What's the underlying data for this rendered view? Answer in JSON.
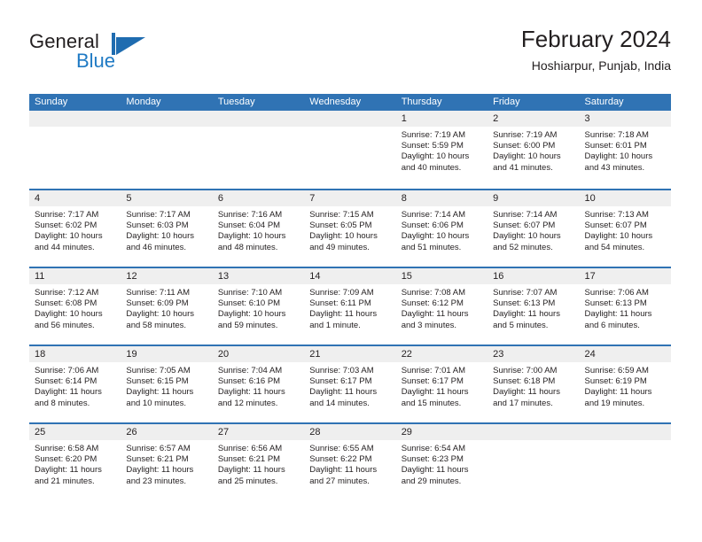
{
  "brand": {
    "name_part1": "General",
    "name_part2": "Blue",
    "accent_color": "#1f7ac4",
    "mark_color": "#1f6cb0"
  },
  "header": {
    "title": "February 2024",
    "subtitle": "Hoshiarpur, Punjab, India"
  },
  "theme": {
    "header_blue": "#3073b4",
    "day_band_gray": "#efefef",
    "text": "#231f20"
  },
  "weekday_headers": [
    "Sunday",
    "Monday",
    "Tuesday",
    "Wednesday",
    "Thursday",
    "Friday",
    "Saturday"
  ],
  "weeks": [
    {
      "days": [
        {
          "num": "",
          "lines": []
        },
        {
          "num": "",
          "lines": []
        },
        {
          "num": "",
          "lines": []
        },
        {
          "num": "",
          "lines": []
        },
        {
          "num": "1",
          "lines": [
            "Sunrise: 7:19 AM",
            "Sunset: 5:59 PM",
            "Daylight: 10 hours",
            "and 40 minutes."
          ]
        },
        {
          "num": "2",
          "lines": [
            "Sunrise: 7:19 AM",
            "Sunset: 6:00 PM",
            "Daylight: 10 hours",
            "and 41 minutes."
          ]
        },
        {
          "num": "3",
          "lines": [
            "Sunrise: 7:18 AM",
            "Sunset: 6:01 PM",
            "Daylight: 10 hours",
            "and 43 minutes."
          ]
        }
      ]
    },
    {
      "days": [
        {
          "num": "4",
          "lines": [
            "Sunrise: 7:17 AM",
            "Sunset: 6:02 PM",
            "Daylight: 10 hours",
            "and 44 minutes."
          ]
        },
        {
          "num": "5",
          "lines": [
            "Sunrise: 7:17 AM",
            "Sunset: 6:03 PM",
            "Daylight: 10 hours",
            "and 46 minutes."
          ]
        },
        {
          "num": "6",
          "lines": [
            "Sunrise: 7:16 AM",
            "Sunset: 6:04 PM",
            "Daylight: 10 hours",
            "and 48 minutes."
          ]
        },
        {
          "num": "7",
          "lines": [
            "Sunrise: 7:15 AM",
            "Sunset: 6:05 PM",
            "Daylight: 10 hours",
            "and 49 minutes."
          ]
        },
        {
          "num": "8",
          "lines": [
            "Sunrise: 7:14 AM",
            "Sunset: 6:06 PM",
            "Daylight: 10 hours",
            "and 51 minutes."
          ]
        },
        {
          "num": "9",
          "lines": [
            "Sunrise: 7:14 AM",
            "Sunset: 6:07 PM",
            "Daylight: 10 hours",
            "and 52 minutes."
          ]
        },
        {
          "num": "10",
          "lines": [
            "Sunrise: 7:13 AM",
            "Sunset: 6:07 PM",
            "Daylight: 10 hours",
            "and 54 minutes."
          ]
        }
      ]
    },
    {
      "days": [
        {
          "num": "11",
          "lines": [
            "Sunrise: 7:12 AM",
            "Sunset: 6:08 PM",
            "Daylight: 10 hours",
            "and 56 minutes."
          ]
        },
        {
          "num": "12",
          "lines": [
            "Sunrise: 7:11 AM",
            "Sunset: 6:09 PM",
            "Daylight: 10 hours",
            "and 58 minutes."
          ]
        },
        {
          "num": "13",
          "lines": [
            "Sunrise: 7:10 AM",
            "Sunset: 6:10 PM",
            "Daylight: 10 hours",
            "and 59 minutes."
          ]
        },
        {
          "num": "14",
          "lines": [
            "Sunrise: 7:09 AM",
            "Sunset: 6:11 PM",
            "Daylight: 11 hours",
            "and 1 minute."
          ]
        },
        {
          "num": "15",
          "lines": [
            "Sunrise: 7:08 AM",
            "Sunset: 6:12 PM",
            "Daylight: 11 hours",
            "and 3 minutes."
          ]
        },
        {
          "num": "16",
          "lines": [
            "Sunrise: 7:07 AM",
            "Sunset: 6:13 PM",
            "Daylight: 11 hours",
            "and 5 minutes."
          ]
        },
        {
          "num": "17",
          "lines": [
            "Sunrise: 7:06 AM",
            "Sunset: 6:13 PM",
            "Daylight: 11 hours",
            "and 6 minutes."
          ]
        }
      ]
    },
    {
      "days": [
        {
          "num": "18",
          "lines": [
            "Sunrise: 7:06 AM",
            "Sunset: 6:14 PM",
            "Daylight: 11 hours",
            "and 8 minutes."
          ]
        },
        {
          "num": "19",
          "lines": [
            "Sunrise: 7:05 AM",
            "Sunset: 6:15 PM",
            "Daylight: 11 hours",
            "and 10 minutes."
          ]
        },
        {
          "num": "20",
          "lines": [
            "Sunrise: 7:04 AM",
            "Sunset: 6:16 PM",
            "Daylight: 11 hours",
            "and 12 minutes."
          ]
        },
        {
          "num": "21",
          "lines": [
            "Sunrise: 7:03 AM",
            "Sunset: 6:17 PM",
            "Daylight: 11 hours",
            "and 14 minutes."
          ]
        },
        {
          "num": "22",
          "lines": [
            "Sunrise: 7:01 AM",
            "Sunset: 6:17 PM",
            "Daylight: 11 hours",
            "and 15 minutes."
          ]
        },
        {
          "num": "23",
          "lines": [
            "Sunrise: 7:00 AM",
            "Sunset: 6:18 PM",
            "Daylight: 11 hours",
            "and 17 minutes."
          ]
        },
        {
          "num": "24",
          "lines": [
            "Sunrise: 6:59 AM",
            "Sunset: 6:19 PM",
            "Daylight: 11 hours",
            "and 19 minutes."
          ]
        }
      ]
    },
    {
      "days": [
        {
          "num": "25",
          "lines": [
            "Sunrise: 6:58 AM",
            "Sunset: 6:20 PM",
            "Daylight: 11 hours",
            "and 21 minutes."
          ]
        },
        {
          "num": "26",
          "lines": [
            "Sunrise: 6:57 AM",
            "Sunset: 6:21 PM",
            "Daylight: 11 hours",
            "and 23 minutes."
          ]
        },
        {
          "num": "27",
          "lines": [
            "Sunrise: 6:56 AM",
            "Sunset: 6:21 PM",
            "Daylight: 11 hours",
            "and 25 minutes."
          ]
        },
        {
          "num": "28",
          "lines": [
            "Sunrise: 6:55 AM",
            "Sunset: 6:22 PM",
            "Daylight: 11 hours",
            "and 27 minutes."
          ]
        },
        {
          "num": "29",
          "lines": [
            "Sunrise: 6:54 AM",
            "Sunset: 6:23 PM",
            "Daylight: 11 hours",
            "and 29 minutes."
          ]
        },
        {
          "num": "",
          "lines": []
        },
        {
          "num": "",
          "lines": []
        }
      ]
    }
  ]
}
